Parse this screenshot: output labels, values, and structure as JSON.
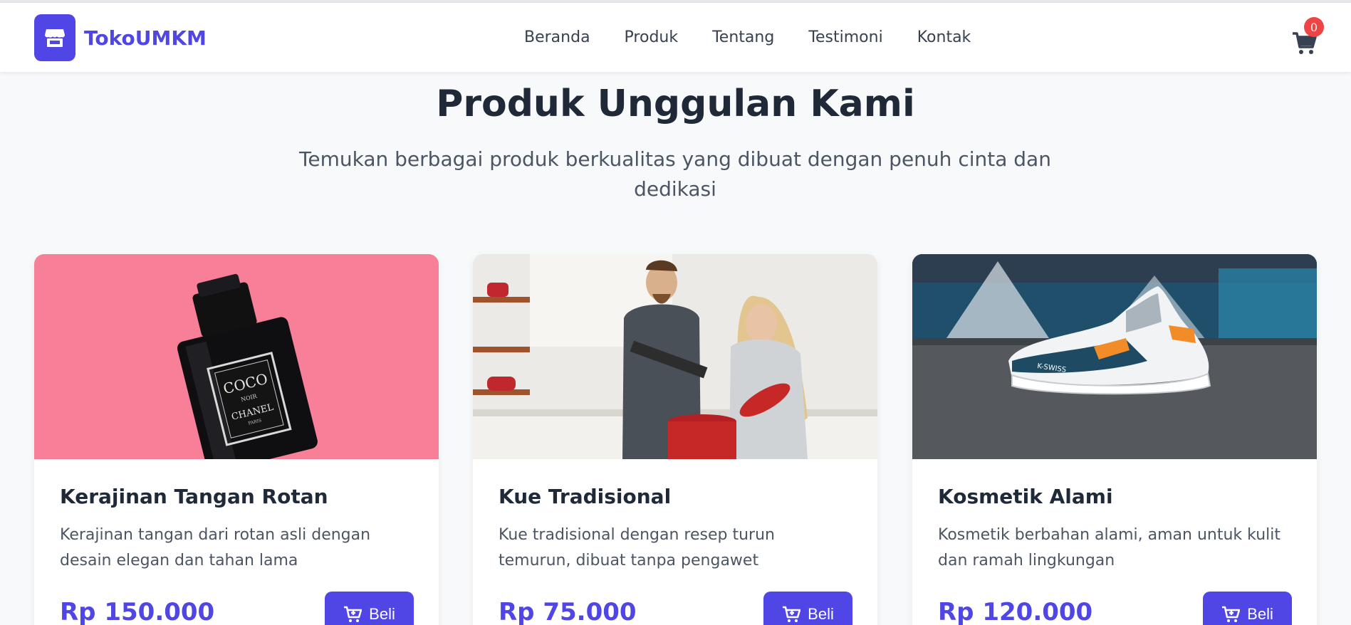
{
  "brand": {
    "name": "TokoUMKM",
    "logo_icon": "store-icon",
    "accent": "#4f46e5"
  },
  "nav": {
    "items": [
      {
        "label": "Beranda"
      },
      {
        "label": "Produk"
      },
      {
        "label": "Tentang"
      },
      {
        "label": "Testimoni"
      },
      {
        "label": "Kontak"
      }
    ]
  },
  "cart": {
    "icon": "cart-icon",
    "count": "0",
    "badge_color": "#ef4444"
  },
  "section": {
    "title": "Produk Unggulan Kami",
    "subtitle": "Temukan berbagai produk berkualitas yang dibuat dengan penuh cinta dan dedikasi"
  },
  "products": [
    {
      "title": "Kerajinan Tangan Rotan",
      "description": "Kerajinan tangan dari rotan asli dengan desain elegan dan tahan lama",
      "price": "Rp 150.000",
      "buy_label": "Beli",
      "image_label_1": "COCO",
      "image_label_2": "NOIR",
      "image_label_3": "CHANEL",
      "image_label_4": "PARIS"
    },
    {
      "title": "Kue Tradisional",
      "description": "Kue tradisional dengan resep turun temurun, dibuat tanpa pengawet",
      "price": "Rp 75.000",
      "buy_label": "Beli"
    },
    {
      "title": "Kosmetik Alami",
      "description": "Kosmetik berbahan alami, aman untuk kulit dan ramah lingkungan",
      "price": "Rp 120.000",
      "buy_label": "Beli",
      "image_label_1": "K-SWISS"
    }
  ]
}
